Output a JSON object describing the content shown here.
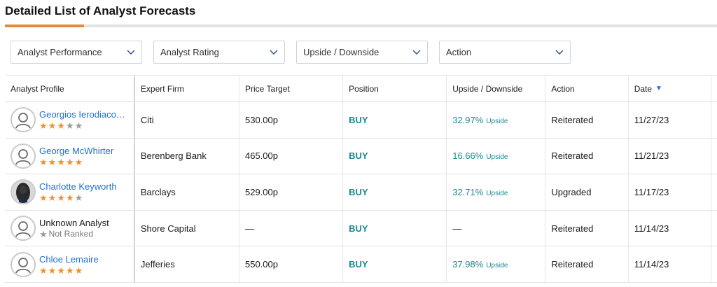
{
  "title": "Detailed List of Analyst Forecasts",
  "accent_color": "#e8893a",
  "link_color": "#1f6fd6",
  "buy_color": "#1a8a8f",
  "filters": [
    {
      "label": "Analyst Performance",
      "icon": "chevron-down-icon"
    },
    {
      "label": "Analyst Rating",
      "icon": "chevron-down-icon"
    },
    {
      "label": "Upside / Downside",
      "icon": "chevron-down-icon"
    },
    {
      "label": "Action",
      "icon": "chevron-down-icon"
    }
  ],
  "columns": [
    "Analyst Profile",
    "Expert Firm",
    "Price Target",
    "Position",
    "Upside / Downside",
    "Action",
    "Date"
  ],
  "sort": {
    "column": "Date",
    "direction": "descending",
    "icon": "sort-down-icon"
  },
  "rows": [
    {
      "analyst": "Georgios Ierodiaco…",
      "stars": 3,
      "ranked": true,
      "firm": "Citi",
      "price_target": "530.00p",
      "position": "BUY",
      "upside": "32.97%",
      "upside_label": "Upside",
      "action": "Reiterated",
      "date": "11/27/23"
    },
    {
      "analyst": "George McWhirter",
      "stars": 5,
      "ranked": true,
      "firm": "Berenberg Bank",
      "price_target": "465.00p",
      "position": "BUY",
      "upside": "16.66%",
      "upside_label": "Upside",
      "action": "Reiterated",
      "date": "11/21/23"
    },
    {
      "analyst": "Charlotte Keyworth",
      "stars": 4,
      "ranked": true,
      "firm": "Barclays",
      "price_target": "529.00p",
      "position": "BUY",
      "upside": "32.71%",
      "upside_label": "Upside",
      "action": "Upgraded",
      "date": "11/17/23"
    },
    {
      "analyst": "Unknown Analyst",
      "stars": 0,
      "ranked": false,
      "not_ranked_label": "Not Ranked",
      "firm": "Shore Capital",
      "price_target": "—",
      "position": "BUY",
      "upside": "—",
      "upside_label": "",
      "action": "Reiterated",
      "date": "11/14/23"
    },
    {
      "analyst": "Chloe Lemaire",
      "stars": 5,
      "ranked": true,
      "firm": "Jefferies",
      "price_target": "550.00p",
      "position": "BUY",
      "upside": "37.98%",
      "upside_label": "Upside",
      "action": "Reiterated",
      "date": "11/14/23"
    }
  ]
}
